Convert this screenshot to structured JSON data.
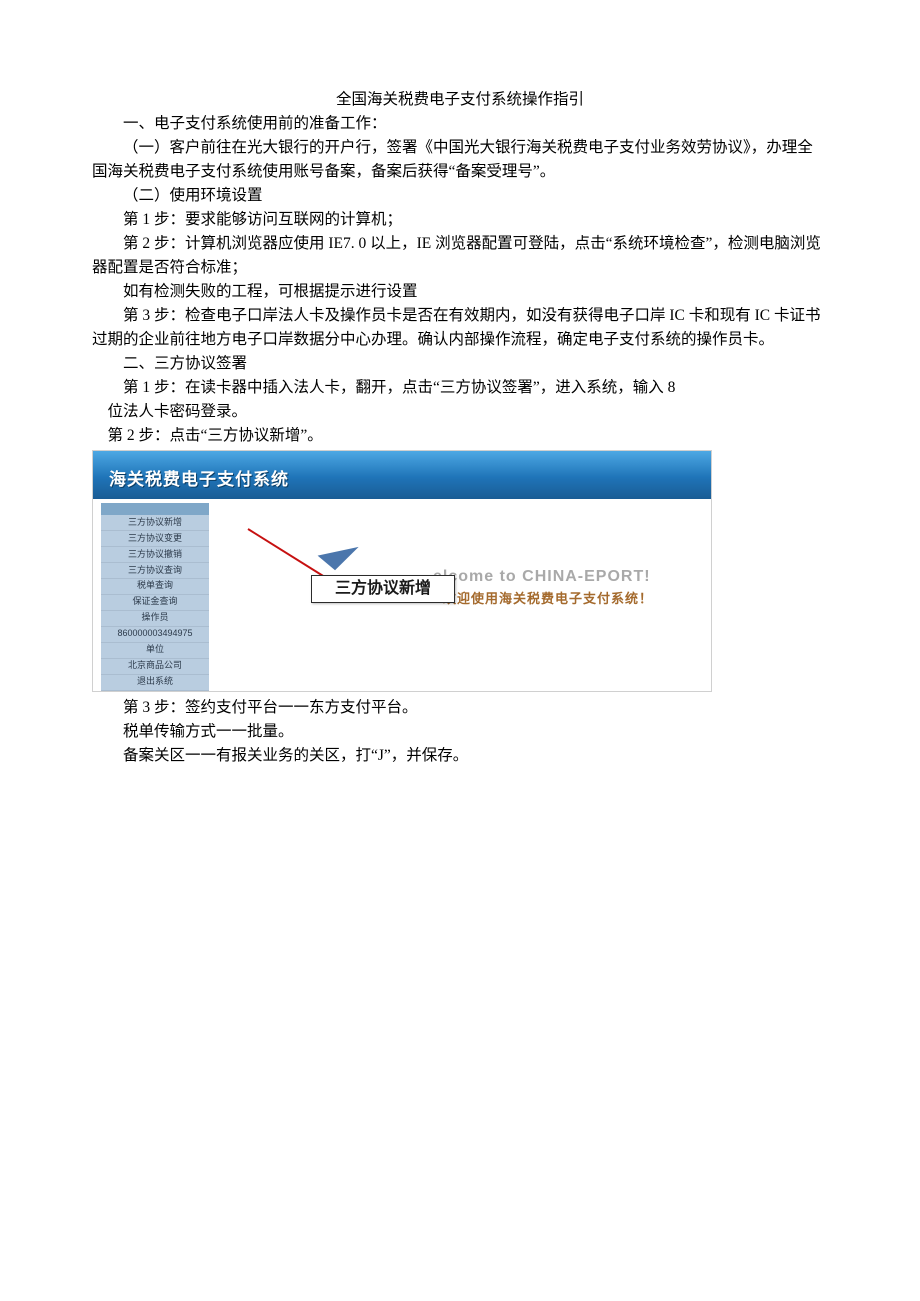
{
  "title": "全国海关税费电子支付系统操作指引",
  "p1": "一、电子支付系统使用前的准备工作：",
  "p2": "（一）客户前往在光大银行的开户行，签署《中国光大银行海关税费电子支付业务效劳协议》，办理全国海关税费电子支付系统使用账号备案，备案后获得“备案受理号”。",
  "p3": "（二）使用环境设置",
  "p4": "第 1 步：要求能够访问互联网的计算机；",
  "p5": "第 2 步：计算机浏览器应使用 IE7. 0 以上，IE 浏览器配置可登陆，点击“系统环境检查”，检测电脑浏览器配置是否符合标准；",
  "p6": "如有检测失败的工程，可根据提示进行设置",
  "p7": "第 3 步：检查电子口岸法人卡及操作员卡是否在有效期内，如没有获得电子口岸 IC 卡和现有 IC 卡证书过期的企业前往地方电子口岸数据分中心办理。确认内部操作流程，确定电子支付系统的操作员卡。",
  "p8": "二、三方协议签署",
  "p9a": "第 1 步：在读卡器中插入法人卡，翻开，点击“三方协议签署”，进入系统，输入 8",
  "p9b": "位法人卡密码登录。",
  "p10": "第 2 步：点击“三方协议新增”。",
  "p11": "第 3 步：签约支付平台一一东方支付平台。",
  "p12": "税单传输方式一一批量。",
  "p13": "备案关区一一有报关业务的关区，打“J”，并保存。",
  "screenshot": {
    "header_title": "海关税费电子支付系统",
    "callout_label": "三方协议新增",
    "welcome_line": "elcome to CHINA-EPORT!",
    "welcome_sub": "欢迎使用海关税费电子支付系统！",
    "sidebar_items": [
      "三方协议新增",
      "三方协议变更",
      "三方协议撤销",
      "三方协议查询",
      "税单查询",
      "保证金查询",
      "操作员",
      "860000003494975",
      "单位",
      "北京商品公司",
      "退出系统"
    ]
  }
}
